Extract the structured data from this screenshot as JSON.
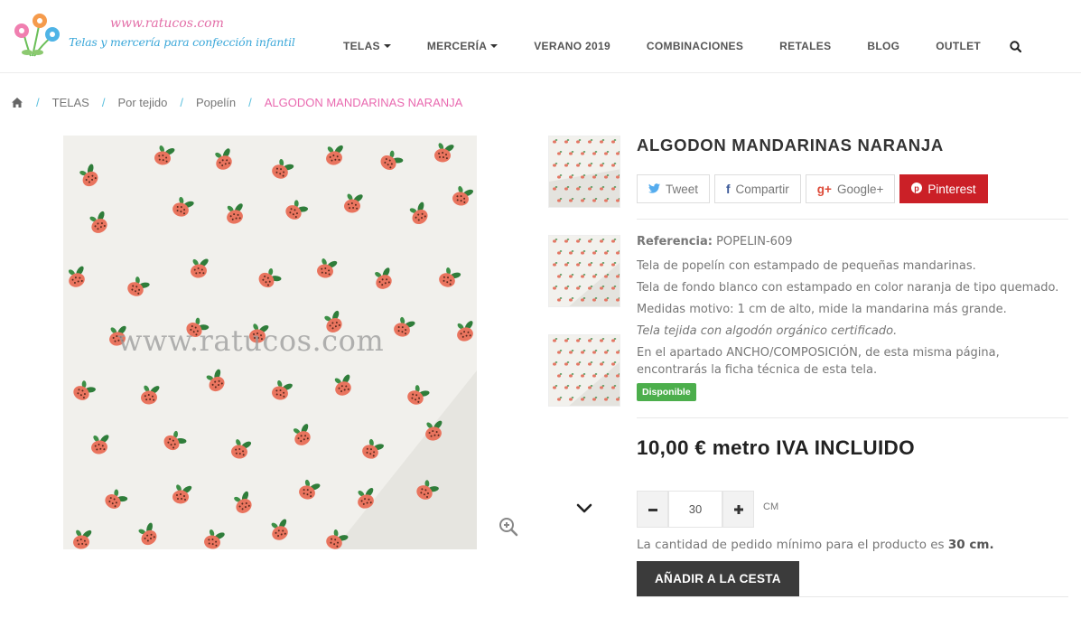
{
  "header": {
    "logo_url": "www.ratucos.com",
    "logo_tagline": "Telas y mercería para confección infantil",
    "nav": [
      {
        "label": "TELAS",
        "has_caret": true
      },
      {
        "label": "MERCERÍA",
        "has_caret": true
      },
      {
        "label": "VERANO 2019",
        "has_caret": false
      },
      {
        "label": "COMBINACIONES",
        "has_caret": false
      },
      {
        "label": "RETALES",
        "has_caret": false
      },
      {
        "label": "BLOG",
        "has_caret": false
      },
      {
        "label": "OUTLET",
        "has_caret": false
      }
    ],
    "search_icon": "search-icon"
  },
  "breadcrumb": {
    "home_icon": "home-icon",
    "items": [
      "TELAS",
      "Por tejido",
      "Popelín"
    ],
    "current": "ALGODON MANDARINAS NARANJA",
    "separator": "/"
  },
  "gallery": {
    "watermark": "www.ratucos.com",
    "zoom_icon": "zoom-in-icon",
    "next_icon": "chevron-down-icon"
  },
  "product": {
    "title": "ALGODON MANDARINAS NARANJA",
    "share": {
      "tweet": "Tweet",
      "share": "Compartir",
      "google": "Google+",
      "pinterest": "Pinterest"
    },
    "reference_label": "Referencia:",
    "reference_value": "POPELIN-609",
    "description": [
      "Tela de popelín con estampado de pequeñas mandarinas.",
      "Tela de fondo blanco con estampado en color naranja de tipo quemado.",
      "Medidas motivo: 1 cm de alto, mide la mandarina más grande.",
      "Tela tejida con algodón orgánico certificado.",
      "En el apartado ANCHO/COMPOSICIÓN, de esta misma página, encontrarás la ficha técnica de esta tela."
    ],
    "availability": "Disponible",
    "price": "10,00 € metro IVA INCLUIDO",
    "quantity": "30",
    "quantity_unit": "CM",
    "minimum_text": "La cantidad de pedido mínimo para el producto es",
    "minimum_value": "30 cm.",
    "add_to_cart": "AÑADIR A LA CESTA"
  },
  "colors": {
    "accent_pink": "#e96ab0",
    "accent_blue": "#5bc0de",
    "pinterest": "#cb2027",
    "available": "#4cae4c",
    "button_dark": "#3b3b3b"
  }
}
